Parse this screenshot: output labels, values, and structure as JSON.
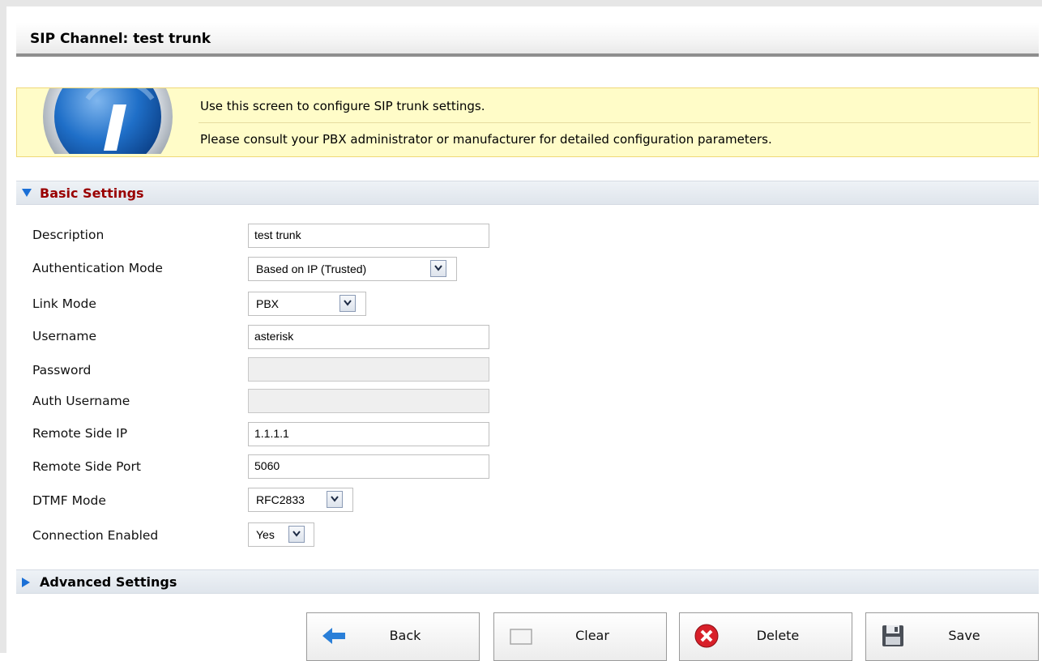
{
  "page": {
    "title": "SIP Channel: test trunk"
  },
  "info": {
    "line1": "Use this screen to configure SIP trunk settings.",
    "line2": "Please consult your PBX administrator or manufacturer for detailed configuration parameters."
  },
  "sections": {
    "basic": "Basic Settings",
    "advanced": "Advanced Settings"
  },
  "form": {
    "description": {
      "label": "Description",
      "value": "test trunk"
    },
    "auth_mode": {
      "label": "Authentication Mode",
      "value": "Based on IP (Trusted)"
    },
    "link_mode": {
      "label": "Link Mode",
      "value": "PBX"
    },
    "username": {
      "label": "Username",
      "value": "asterisk"
    },
    "password": {
      "label": "Password",
      "value": ""
    },
    "auth_username": {
      "label": "Auth Username",
      "value": ""
    },
    "remote_ip": {
      "label": "Remote Side IP",
      "value": "1.1.1.1"
    },
    "remote_port": {
      "label": "Remote Side Port",
      "value": "5060"
    },
    "dtmf_mode": {
      "label": "DTMF Mode",
      "value": "RFC2833"
    },
    "connection_enabled": {
      "label": "Connection Enabled",
      "value": "Yes"
    }
  },
  "buttons": {
    "back": "Back",
    "clear": "Clear",
    "delete": "Delete",
    "save": "Save"
  },
  "colors": {
    "basic_header_text": "#990000",
    "info_background": "#fffcc8",
    "arrow_blue": "#1a6fd6"
  }
}
